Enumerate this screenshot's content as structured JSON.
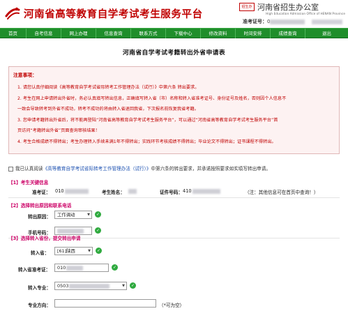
{
  "header": {
    "site_title": "河南省高等教育自学考试考生服务平台",
    "office_seal": "招生办",
    "office_name_cn": "河南省招生办公室",
    "office_name_en": "High Education Admission Office of HENAN Province",
    "user_label": "准考证号：",
    "user_id_prefix": "0",
    "brand_color": "#c00000"
  },
  "nav": {
    "color": "#1f8e2b",
    "items": [
      "首页",
      "自考信息",
      "网上办理",
      "信息查询",
      "联系方式",
      "下载中心",
      "修改资料",
      "时间安排",
      "成绩查询",
      "退出"
    ]
  },
  "page": {
    "title": "河南省自学考试考籍转出外省申请表"
  },
  "notice": {
    "title": "注意事项：",
    "lines": [
      "1. 请您认真仔细阅读《高等教育自学考试省际转考工作管理办法（试行）》中第六条 转出要求。",
      "2. 考生在网上申请转出外省时，务必认真填写转出信息，正确填写转入省（市）名称和转入省准考证号、身份证号及姓名，否则因个人信息不",
      "一致会导致转考到外省不成功，转考不成功的将由转入省退回我省，下次报名前恢复我省考籍。",
      "3. 您申请考籍转出外省后，将不能再登陆“河南省高等教育自学考试考生服务平台”，可以通过“河南省高等教育自学考试考生服务平台”首",
      "页访问“考籍转出外省”页面查询审核结果！",
      "4. 考生合格成绩不得转出；考生办理转入手续未满1年不得转出；实践环节考核成绩不得转出；毕业论文不得转出；证书课程不得转出。"
    ]
  },
  "agreement": {
    "prefix": "我已认真阅读",
    "link": "《高等教育自学考试省际转考工作管理办法（试行）》",
    "suffix": "中第六条的转出要求，并承诺按照要求如实填写转出申请。"
  },
  "section1": {
    "title": "【1】考生关键信息",
    "exam_no_label": "准考证：",
    "exam_no_value": "010",
    "name_label": "考生姓名：",
    "id_label": "证件号码：",
    "id_value": "410",
    "note": "（注：其他信息可在首页中查询！）"
  },
  "section2": {
    "title": "【2】选择转出原因和联系电话",
    "reason_label": "转出原因：",
    "reason_value": "工作调动",
    "phone_label": "手机号码："
  },
  "section3": {
    "title": "【3】选择转入省份，提交转出申请",
    "province_label": "转入省：",
    "province_value": "[61]陕西",
    "target_no_label": "转入省准考证：",
    "target_no_value": "010",
    "major_label": "转入专业：",
    "major_value": "0503",
    "direction_label": "专业方向：",
    "direction_note": "（*可为空）"
  }
}
